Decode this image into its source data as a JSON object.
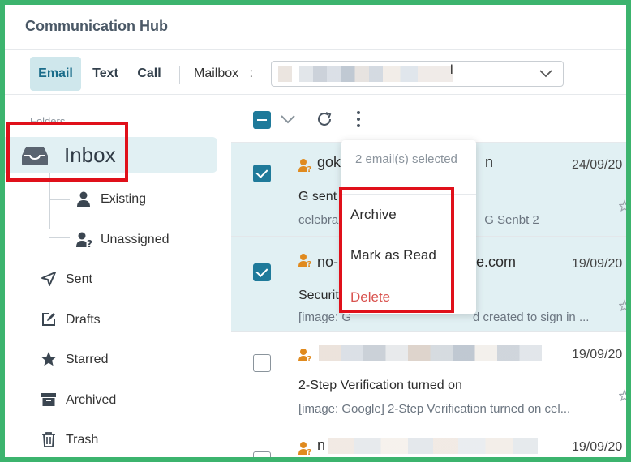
{
  "app": {
    "title": "Communication Hub"
  },
  "channels": {
    "tabs": [
      {
        "label": "Email",
        "active": true
      },
      {
        "label": "Text",
        "active": false
      },
      {
        "label": "Call",
        "active": false
      }
    ],
    "mailbox_label": "Mailbox",
    "mailbox_colon": ":",
    "mailbox_value_tail": "l"
  },
  "sidebar": {
    "folders_label": "Folders",
    "inbox": {
      "label": "Inbox",
      "icon": "inbox-tray-icon"
    },
    "inbox_children": [
      {
        "label": "Existing",
        "icon": "person-icon"
      },
      {
        "label": "Unassigned",
        "icon": "person-question-icon"
      }
    ],
    "items": [
      {
        "label": "Sent",
        "icon": "send-icon"
      },
      {
        "label": "Drafts",
        "icon": "drafts-icon"
      },
      {
        "label": "Starred",
        "icon": "star-icon"
      },
      {
        "label": "Archived",
        "icon": "archive-icon"
      },
      {
        "label": "Trash",
        "icon": "trash-icon"
      }
    ]
  },
  "toolbar": {
    "select_all_state": "indeterminate",
    "icons": [
      "select-caret-icon",
      "refresh-icon",
      "more-vertical-icon"
    ]
  },
  "dropdown": {
    "header": "2 email(s) selected",
    "items": [
      {
        "label": "Archive"
      },
      {
        "label": "Mark as Read"
      },
      {
        "label": "Delete",
        "danger": true
      }
    ]
  },
  "emails": [
    {
      "selected": true,
      "from_visible": "gok",
      "from_tail": "n",
      "date": "24/09/20",
      "subject": "G sent",
      "preview": "celebra",
      "preview_tail": "G Senbt 2"
    },
    {
      "selected": true,
      "from_visible": "no-",
      "from_tail": "ogle.com",
      "date": "19/09/20",
      "subject": "Securit",
      "preview": "[image: G",
      "preview_tail": "d created to sign in ..."
    },
    {
      "selected": false,
      "from_visible": "",
      "from_tail": "",
      "date": "19/09/20",
      "subject": "2-Step Verification turned on",
      "preview": "[image: Google] 2-Step Verification turned on cel..."
    },
    {
      "selected": false,
      "from_visible": "n",
      "from_tail": "",
      "date": "19/09/20",
      "subject": "",
      "preview": ""
    }
  ],
  "colors": {
    "accent": "#1f7a9a",
    "selected_row": "#e1f0f3",
    "icon_orange": "#e08a1e",
    "danger": "#d9534f",
    "highlight": "#e0101a",
    "frame": "#3cb46e"
  }
}
